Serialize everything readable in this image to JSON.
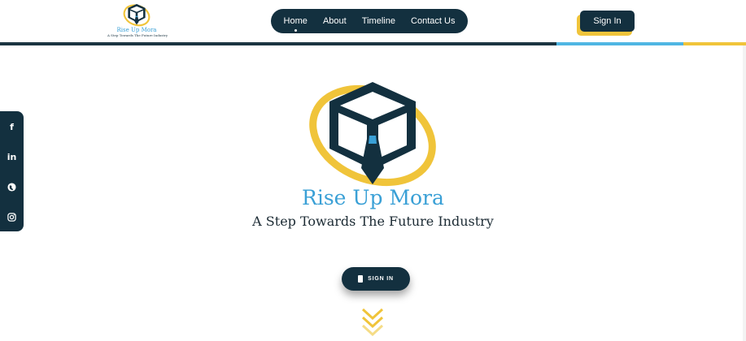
{
  "header": {
    "logo": {
      "title": "Rise Up Mora",
      "tagline": "A Step Towards The Future Industry"
    },
    "nav": [
      {
        "label": "Home",
        "active": true
      },
      {
        "label": "About"
      },
      {
        "label": "Timeline"
      },
      {
        "label": "Contact Us"
      }
    ],
    "signin_label": "Sign In"
  },
  "social": [
    {
      "name": "facebook-icon",
      "glyph": "f"
    },
    {
      "name": "linkedin-icon",
      "glyph": "in"
    },
    {
      "name": "globe-icon",
      "glyph": "●"
    },
    {
      "name": "instagram-icon",
      "glyph": "◎"
    }
  ],
  "hero": {
    "title": "Rise Up Mora",
    "subtitle": "A Step Towards The Future Industry",
    "cta_label": "SIGN IN"
  },
  "colors": {
    "navy": "#13303f",
    "blue": "#3aa0d6",
    "yellow": "#f0c43a"
  }
}
